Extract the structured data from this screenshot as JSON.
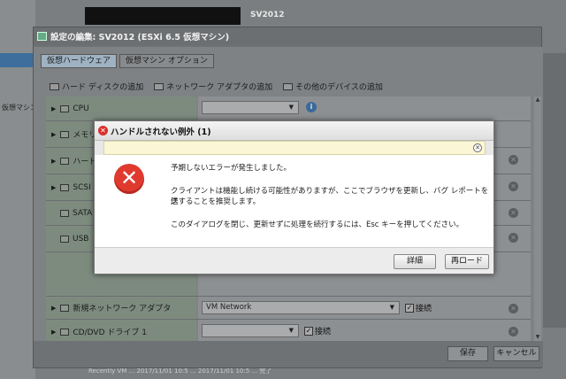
{
  "background": {
    "vm_name": "SV2012",
    "sidebar_text": "仮想マシン",
    "bottom_row": "Recently VM   ...   2017/11/01 10:5 ...   2017/11/01 10:5 ...   完了"
  },
  "dialog": {
    "title": "設定の編集: SV2012 (ESXi 6.5 仮想マシン)",
    "tabs": [
      {
        "label": "仮想ハードウェア"
      },
      {
        "label": "仮想マシン オプション"
      }
    ],
    "toolbar": {
      "add_hdd": "ハード ディスクの追加",
      "add_nic": "ネットワーク アダプタの追加",
      "add_other": "その他のデバイスの追加"
    },
    "rows": {
      "cpu": "CPU",
      "memory": "メモリ",
      "hdd": "ハード",
      "scsi": "SCSI",
      "sata": "SATA",
      "usb": "USB",
      "nic": "新規ネットワーク アダプタ",
      "cdrom": "CD/DVD ドライブ 1"
    },
    "nic_network": "VM Network",
    "connect_label": "接続",
    "save_label": "保存",
    "cancel_label": "キャンセル"
  },
  "error": {
    "title": "ハンドルされない例外 (1)",
    "line1": "予期しないエラーが発生しました。",
    "line2": "クライアントは機能し続ける可能性がありますが、ここでブラウザを更新し、バグ レポートを送",
    "line3": "信することを推奨します。",
    "line4": "このダイアログを閉じ、更新せずに処理を続行するには、Esc キーを押してください。",
    "details_label": "詳細",
    "reload_label": "再ロード"
  }
}
